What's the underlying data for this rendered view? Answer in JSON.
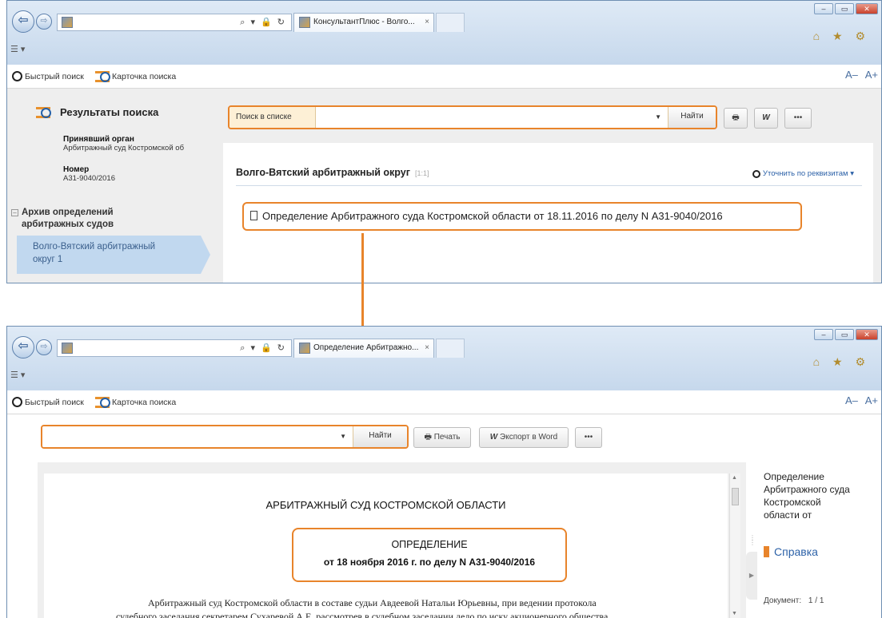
{
  "top": {
    "browser": {
      "tab_title": "КонсультантПлюс - Волго...",
      "tab_close": "×",
      "address_icons": "⌕ ▾ 🔒 ↻",
      "menu_glyph": "☰ ▾",
      "window_controls": [
        "–",
        "▭",
        "✕"
      ],
      "ie_icons": "⌂ ★ ⚙"
    },
    "app_bar": {
      "quick_search": "Быстрый поиск",
      "search_card": "Карточка поиска",
      "font_size": "A– A+"
    },
    "sidebar": {
      "title": "Результаты поиска",
      "authority_label": "Принявший орган",
      "authority_value": "Арбитражный суд Костромской об",
      "number_label": "Номер",
      "number_value": "А31-9040/2016",
      "archive_toggle": "–",
      "archive_line1": "Архив определений",
      "archive_line2": "арбитражных судов",
      "selected_line1": "Волго-Вятский арбитражный",
      "selected_line2": "округ 1"
    },
    "search": {
      "label": "Поиск в списке",
      "value": "",
      "find_button": "Найти",
      "print_icon_text": "🖶",
      "word_icon_text": "W",
      "more": "•••"
    },
    "results": {
      "heading": "Волго-Вятский арбитражный округ",
      "count": "[1:1]",
      "refine": "Уточнить по реквизитам ▾",
      "document": "Определение Арбитражного суда Костромской области от 18.11.2016 по делу N А31-9040/2016"
    }
  },
  "bottom": {
    "browser": {
      "tab_title": "Определение Арбитражно...",
      "tab_close": "×",
      "address_icons": "⌕ ▾ 🔒 ↻",
      "menu_glyph": "☰ ▾",
      "window_controls": [
        "–",
        "▭",
        "✕"
      ],
      "ie_icons": "⌂ ★ ⚙"
    },
    "app_bar": {
      "quick_search": "Быстрый поиск",
      "search_card": "Карточка поиска",
      "font_size": "A– A+"
    },
    "toolbar": {
      "search_value": "",
      "find_button": "Найти",
      "print_button": "Печать",
      "export_button": "Экспорт в Word",
      "more": "•••"
    },
    "document": {
      "court": "АРБИТРАЖНЫЙ СУД КОСТРОМСКОЙ ОБЛАСТИ",
      "title": "ОПРЕДЕЛЕНИЕ",
      "date_line": "от 18 ноября 2016 г. по делу N А31-9040/2016",
      "paragraph_line1": "Арбитражный суд Костромской области в составе судьи Авдеевой Натальи Юрьевны, при ведении протокола",
      "paragraph_line2": "судебного заседания секретарем Сухаревой А.Е, рассмотрев в судебном заседании дело по иску акционерного общества"
    },
    "right_panel": {
      "doc_name": "Определение Арбитражного суда Костромской области от",
      "help_link": "Справка",
      "doc_counter_label": "Документ:",
      "doc_counter_value": "1 / 1"
    }
  },
  "colors": {
    "highlight": "#e8842b",
    "link_blue": "#2d62a8",
    "selected_bg": "#c1d8ef"
  }
}
